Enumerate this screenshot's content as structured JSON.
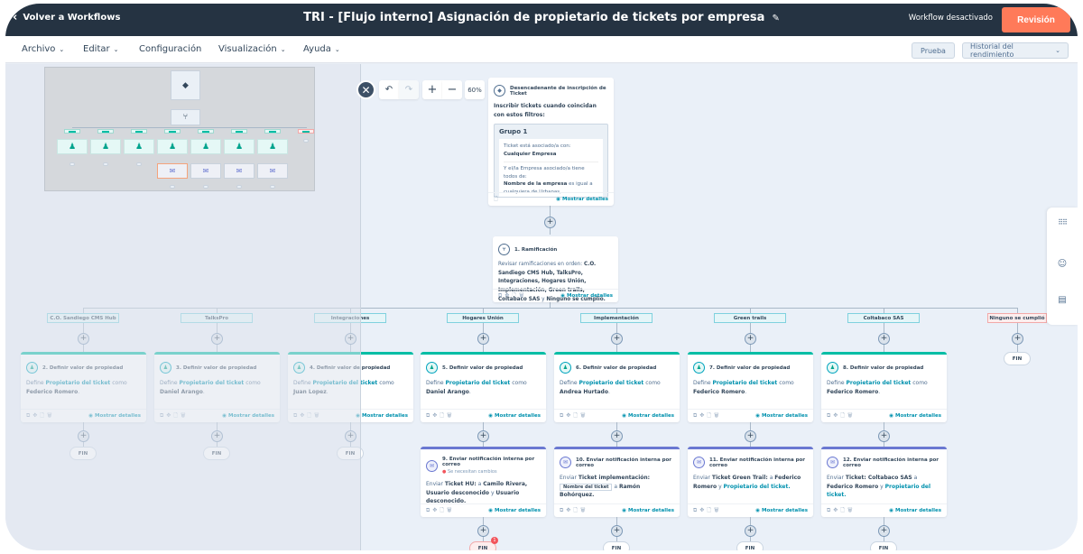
{
  "topbar": {
    "back_label": "Volver a Workflows",
    "title": "TRI - [Flujo interno] Asignación de propietario de tickets por empresa",
    "status": "Workflow desactivado",
    "review_label": "Revisión",
    "accent_color": "#ff7a59"
  },
  "menubar": {
    "items": [
      "Archivo",
      "Editar",
      "Configuración",
      "Visualización",
      "Ayuda"
    ],
    "test_label": "Prueba",
    "history_label": "Historial del rendimiento"
  },
  "controls": {
    "zoom_level": "60%",
    "undo": "undo-icon",
    "redo": "redo-icon",
    "zoom_in": "+",
    "zoom_out": "−"
  },
  "trigger": {
    "title": "Desencadenante de inscripción de Ticket",
    "intro": "Inscribir tickets cuando coincidan con estos filtros:",
    "group": "Grupo 1",
    "cond1_label": "Ticket está asociado/a con:",
    "cond1_value": "Cualquier Empresa",
    "cond2_label": "Y el/la Empresa asociado/a tiene todos de:",
    "cond3_prop": "Nombre de la empresa",
    "cond3_rest": " es igual a cualquiera de Urbanas, Urbanizadora...",
    "show": "Mostrar detalles"
  },
  "branch_node": {
    "title": "1. Ramificación",
    "text_prefix": "Revisar ramificaciones en orden: ",
    "text_bold": "C.O. Sandiego CMS Hub, TalksPro, Integraciones, Hogares Unión, Implementación, Green trails, Coltabaco SAS",
    "text_and": " y ",
    "text_last": "Ninguno se cumplió.",
    "show": "Mostrar detalles"
  },
  "branches": [
    {
      "label": "C.O. Sandiego CMS Hub",
      "step": "2. Definir valor de propiedad",
      "owner": "Federico Romero",
      "faded": true
    },
    {
      "label": "TalksPro",
      "step": "3. Definir valor de propiedad",
      "owner": "Daniel Arango",
      "faded": true
    },
    {
      "label": "Integraciones",
      "step": "4. Definir valor de propiedad",
      "owner": "Juan Lopez",
      "faded": true
    },
    {
      "label": "Hogares Unión",
      "step": "5. Definir valor de propiedad",
      "owner": "Daniel Arango",
      "faded": false
    },
    {
      "label": "Implementación",
      "step": "6. Definir valor de propiedad",
      "owner": "Andrea Hurtado",
      "faded": false
    },
    {
      "label": "Green trails",
      "step": "7. Definir valor de propiedad",
      "owner": "Federico Romero",
      "faded": false
    },
    {
      "label": "Coltabaco SAS",
      "step": "8. Definir valor de propiedad",
      "owner": "Federico Romero",
      "faded": false
    },
    {
      "label": "Ninguno se cumplió",
      "none": true
    }
  ],
  "prop_card": {
    "define": "Define ",
    "prop": "Propietario del ticket",
    "como": " como ",
    "show": "Mostrar detalles"
  },
  "mail_cards": [
    {
      "step": "9. Enviar notificación interna por correo",
      "warning": "Se necesitan cambios",
      "pre": "Enviar ",
      "b1": "Ticket HU:",
      "mid": "  a ",
      "b2": "Camilo Rivera, Usuario desconocido",
      "and": " y ",
      "b3": "Usuario desconocido."
    },
    {
      "step": "10. Enviar notificación interna por correo",
      "pre": "Enviar ",
      "b1": "Ticket implementación:",
      "token": "Nombre del ticket",
      "mid": " a ",
      "b2": "Ramón Bohórquez."
    },
    {
      "step": "11. Enviar notificación interna por correo",
      "pre": "Enviar ",
      "b1": "Ticket Green Trail:",
      "mid": " a ",
      "b2": "Federico Romero",
      "and": " y ",
      "link": "Propietario del ticket."
    },
    {
      "step": "12. Enviar notificación interna por correo",
      "pre": "Enviar ",
      "b1": "Ticket: Coltabaco SAS",
      "mid": " a ",
      "b2": "Federico Romero",
      "and": " y ",
      "link": "Propietario del ticket."
    }
  ],
  "fin_label": "FIN",
  "error_badge": "1",
  "rail": [
    "apps-icon",
    "assistant-icon",
    "chat-icon"
  ]
}
